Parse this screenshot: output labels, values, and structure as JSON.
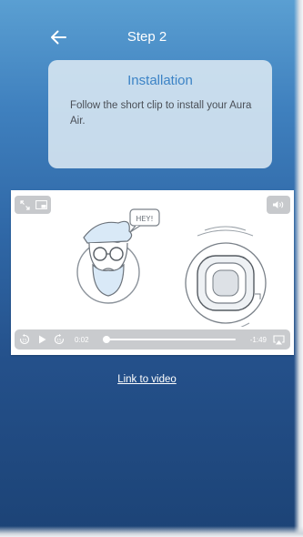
{
  "header": {
    "title": "Step 2"
  },
  "card": {
    "title": "Installation",
    "body": "Follow the short clip to install your Aura Air."
  },
  "video": {
    "bubble_text": "HEY!",
    "current_time": "0:02",
    "remaining_time": "-1:49",
    "progress": 0.02
  },
  "link": {
    "label": "Link to video"
  },
  "colors": {
    "accent": "#3c83c6",
    "background_top": "#5a9fd2",
    "background_bottom": "#1c4376",
    "card": "#dbe8f3"
  }
}
